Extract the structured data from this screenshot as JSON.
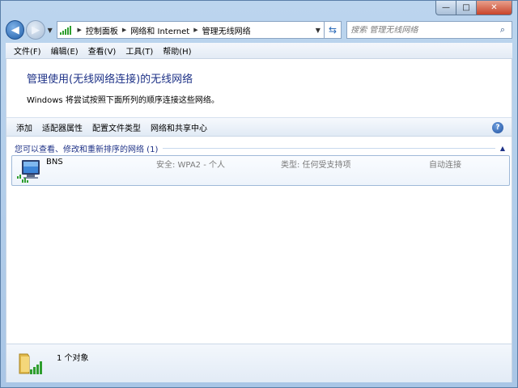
{
  "window": {
    "caption_min": "—",
    "caption_max": "□",
    "caption_close": "✕"
  },
  "address": {
    "back_glyph": "◀",
    "forward_glyph": "▶",
    "crumbs": [
      "控制面板",
      "网络和 Internet",
      "管理无线网络"
    ],
    "search_placeholder": "搜索 管理无线网络"
  },
  "menu": {
    "items": [
      "文件(F)",
      "编辑(E)",
      "查看(V)",
      "工具(T)",
      "帮助(H)"
    ]
  },
  "header": {
    "title": "管理使用(无线网络连接)的无线网络",
    "description": "Windows 将尝试按照下面所列的顺序连接这些网络。"
  },
  "commands": {
    "items": [
      "添加",
      "适配器属性",
      "配置文件类型",
      "网络和共享中心"
    ],
    "help_glyph": "?"
  },
  "list": {
    "group_title": "您可以查看、修改和重新排序的网络 (1)",
    "networks": [
      {
        "name": "BNS",
        "security": "安全: WPA2 - 个人",
        "type": "类型: 任何受支持项",
        "connect": "自动连接"
      }
    ]
  },
  "status": {
    "count_text": "1 个对象"
  },
  "colors": {
    "accent_title": "#1e3287",
    "signal_green": "#2e9e2e",
    "frame_blue": "#a9c6e6"
  }
}
